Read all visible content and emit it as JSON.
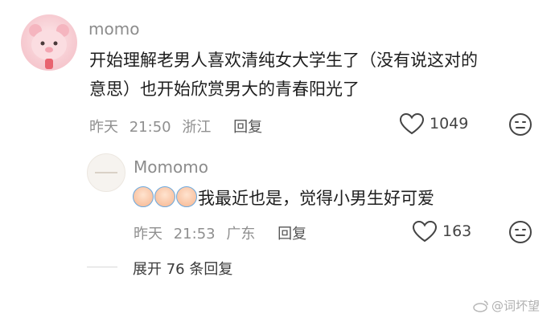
{
  "comment": {
    "username": "momo",
    "text_line1": "开始理解老男人喜欢清纯女大学生了（没有说这对的",
    "text_line2": "意思）也开始欣赏男大的青春阳光了",
    "date": "昨天",
    "time": "21:50",
    "location": "浙江",
    "reply_label": "回复",
    "likes": "1049"
  },
  "reply": {
    "username": "Momomo",
    "text": "我最近也是，觉得小男生好可爱",
    "date": "昨天",
    "time": "21:53",
    "location": "广东",
    "reply_label": "回复",
    "likes": "163",
    "sticker_icon": "smiling-face-sticker"
  },
  "expand": {
    "label": "展开 76 条回复"
  },
  "watermark": {
    "text": "@词坏望"
  },
  "colors": {
    "username": "#8c8c8c",
    "meta": "#8f8f8f",
    "text": "#1e1e1e"
  }
}
